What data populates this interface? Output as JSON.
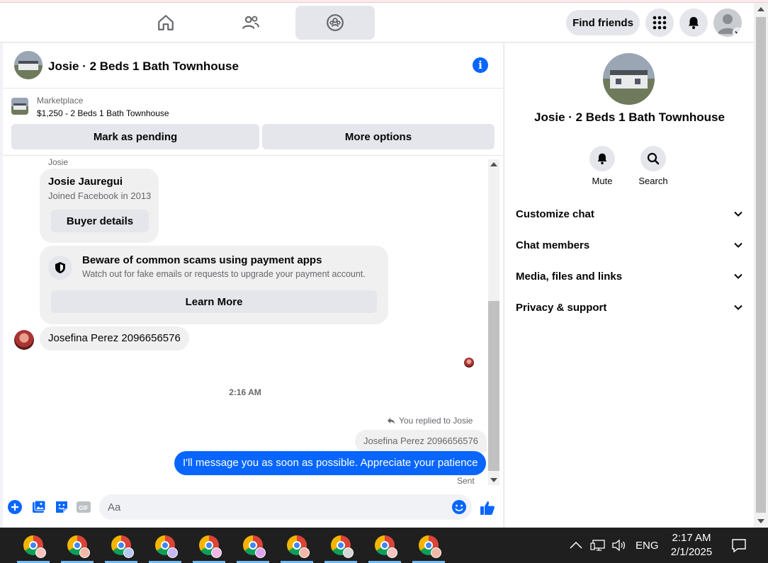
{
  "header": {
    "find_friends": "Find friends"
  },
  "chat": {
    "title": "Josie · 2 Beds 1 Bath Townhouse",
    "marketplace_label": "Marketplace",
    "listing": "$1,250 - 2 Beds 1 Bath Townhouse",
    "mark_pending": "Mark as pending",
    "more_options": "More options",
    "sender_label": "Josie",
    "buyer": {
      "name": "Josie Jauregui",
      "joined": "Joined Facebook in 2013",
      "details_button": "Buyer details"
    },
    "scam_warning": {
      "title": "Beware of common scams using payment apps",
      "body": "Watch out for fake emails or requests to upgrade your payment account.",
      "button": "Learn More"
    },
    "incoming_message": "Josefina Perez 2096656576",
    "timestamp": "2:16 AM",
    "reply_label": "You replied to Josie",
    "reply_quote": "Josefina Perez 2096656576",
    "outgoing_message": "I'll message you as soon as possible. Appreciate your patience",
    "status": "Sent",
    "composer_placeholder": "Aa"
  },
  "side": {
    "title": "Josie · 2 Beds 1 Bath Townhouse",
    "mute": "Mute",
    "search": "Search",
    "sections": [
      "Customize chat",
      "Chat members",
      "Media, files and links",
      "Privacy & support"
    ]
  },
  "taskbar": {
    "language": "ENG",
    "time": "2:17 AM",
    "date": "2/1/2025"
  },
  "colors": {
    "accent": "#0866ff",
    "taskbar": "#1f1f1f"
  }
}
